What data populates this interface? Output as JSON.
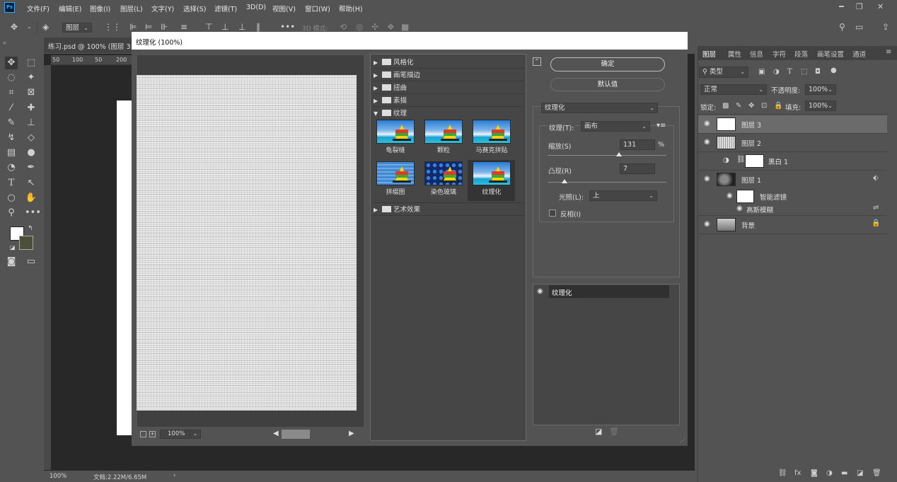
{
  "app": {
    "logo": "Ps"
  },
  "menu": [
    "文件(F)",
    "编辑(E)",
    "图像(I)",
    "图层(L)",
    "文字(Y)",
    "选择(S)",
    "滤镜(T)",
    "3D(D)",
    "视图(V)",
    "窗口(W)",
    "帮助(H)"
  ],
  "options_bar": {
    "layer_select": "图层",
    "mode_3d": "3D 模式:"
  },
  "document": {
    "tab_title": "练习.psd @ 100% (图层 3",
    "zoom": "100%",
    "doc_info": "文档:2.22M/6.65M",
    "ruler_ticks": [
      "50",
      "100",
      "50",
      "200"
    ]
  },
  "dialog": {
    "title": "纹理化 (100%)",
    "preview_zoom": "100%",
    "ok": "确定",
    "default": "默认值",
    "catalog": {
      "folders": [
        "风格化",
        "画笔描边",
        "扭曲",
        "素描",
        "纹理",
        "艺术效果"
      ],
      "texture_filters": [
        "龟裂缝",
        "颗粒",
        "马赛克拼贴",
        "拼缀图",
        "染色玻璃",
        "纹理化"
      ],
      "selected": "纹理化"
    },
    "filter_select": "纹理化",
    "settings": {
      "texture_label": "纹理(T):",
      "texture_value": "画布",
      "scale_label": "缩放(S)",
      "scale_value": "131",
      "scale_unit": "%",
      "scale_fraction": 0.6,
      "relief_label": "凸现(R)",
      "relief_value": "7",
      "relief_fraction": 0.14,
      "light_label": "光照(L):",
      "light_value": "上",
      "invert_label": "反相(I)",
      "invert_checked": false
    },
    "effect_layers": [
      "纹理化"
    ]
  },
  "layers_panel": {
    "tabs": [
      "图层",
      "属性",
      "信息",
      "字符",
      "段落",
      "画笔设置",
      "通道"
    ],
    "kind_filter": "类型",
    "blend_mode": "正常",
    "opacity_label": "不透明度:",
    "opacity": "100%",
    "lock_label": "锁定:",
    "fill_label": "填充:",
    "fill": "100%",
    "layers": [
      {
        "name": "图层 3"
      },
      {
        "name": "图层 2"
      },
      {
        "name": "黑白 1"
      },
      {
        "name": "图层 1"
      },
      {
        "name": "智能滤镜"
      },
      {
        "name": "高斯模糊"
      },
      {
        "name": "背景"
      }
    ]
  }
}
